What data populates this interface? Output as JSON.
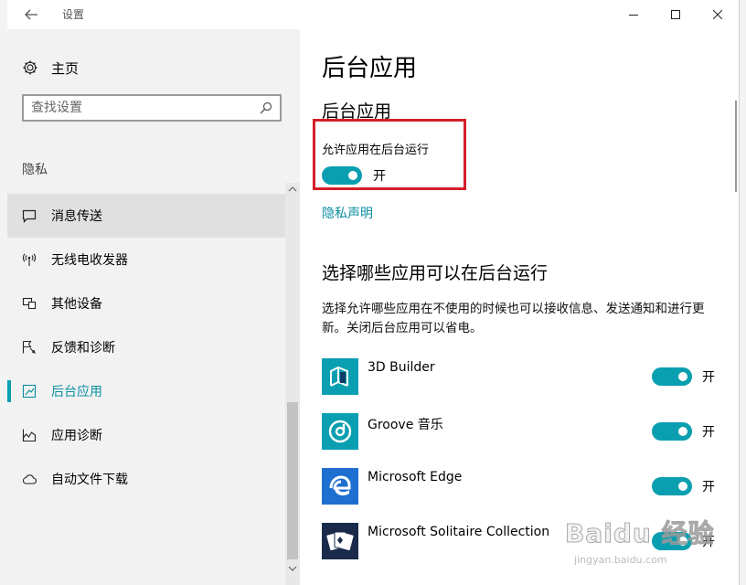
{
  "window": {
    "title": "设置"
  },
  "sidebar": {
    "home_label": "主页",
    "search": {
      "placeholder": "查找设置",
      "value": ""
    },
    "section_label": "隐私",
    "items": [
      {
        "label": "消息传送",
        "icon": "message-icon",
        "state": "hover"
      },
      {
        "label": "无线电收发器",
        "icon": "radio-icon"
      },
      {
        "label": "其他设备",
        "icon": "devices-icon"
      },
      {
        "label": "反馈和诊断",
        "icon": "feedback-icon"
      },
      {
        "label": "后台应用",
        "icon": "background-apps-icon",
        "state": "selected"
      },
      {
        "label": "应用诊断",
        "icon": "diagnostics-icon"
      },
      {
        "label": "自动文件下载",
        "icon": "cloud-icon"
      }
    ]
  },
  "content": {
    "page_title": "后台应用",
    "section_title": "后台应用",
    "allow_label": "允许应用在后台运行",
    "allow_toggle_state": "开",
    "privacy_link": "隐私声明",
    "choose_title": "选择哪些应用可以在后台运行",
    "description": "选择允许哪些应用在不使用的时候也可以接收信息、发送通知和进行更新。关闭后台应用可以省电。",
    "apps": [
      {
        "name": "3D Builder",
        "state": "开",
        "tile_color": "#0a9fb0"
      },
      {
        "name": "Groove 音乐",
        "state": "开",
        "tile_color": "#0a9fb0"
      },
      {
        "name": "Microsoft Edge",
        "state": "开",
        "tile_color": "#1e6fd0"
      },
      {
        "name": "Microsoft Solitaire Collection",
        "state": "开",
        "tile_color": "#1a2a4a"
      }
    ]
  },
  "colors": {
    "accent": "#0a9fb0",
    "highlight_box": "#d4202a"
  },
  "watermark": {
    "logo": "Baidu 经验",
    "url": "jingyan.baidu.com"
  }
}
